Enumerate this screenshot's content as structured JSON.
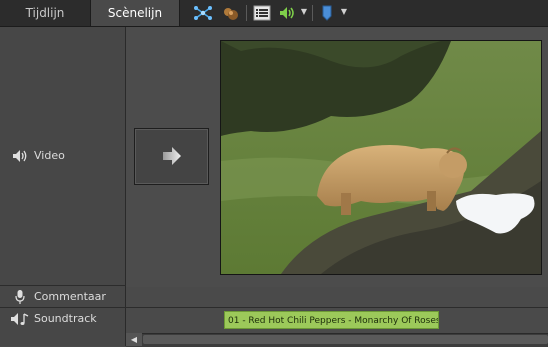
{
  "tabs": [
    {
      "label": "Tijdlijn",
      "active": false
    },
    {
      "label": "Scènelijn",
      "active": true
    }
  ],
  "toolbar": {
    "icons": [
      "smart-fix-icon",
      "effects-icon",
      "properties-icon",
      "audio-mixer-icon",
      "marker-icon"
    ]
  },
  "tracks": {
    "video": "Video",
    "narration": "Commentaar",
    "soundtrack": "Soundtrack"
  },
  "audio_clip": {
    "title": "01 - Red Hot Chili Peppers - Monarchy Of Roses..."
  },
  "colors": {
    "audio_clip": "#9cc95a",
    "active_tab": "#4a4a4a",
    "toolbar": "#2c2c2c"
  }
}
